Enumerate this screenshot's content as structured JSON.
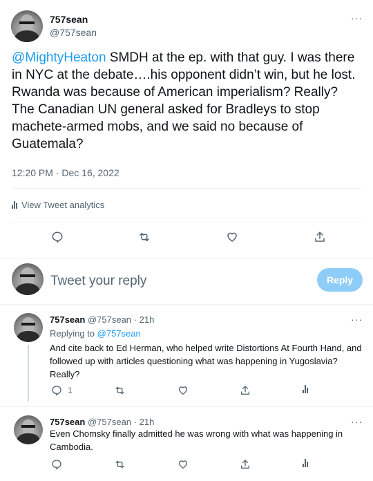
{
  "main_tweet": {
    "author_name": "757sean",
    "author_handle": "@757sean",
    "mention": "@MightyHeaton",
    "text": " SMDH at the ep. with that guy. I was there in NYC at the debate….his opponent didn’t win, but he lost. Rwanda was because of American imperialism? Really? The Canadian UN general asked for Bradleys to stop machete-armed mobs, and we said no because of Guatemala?",
    "timestamp": "12:20 PM · Dec 16, 2022",
    "analytics_label": "View Tweet analytics",
    "more_icon": "···"
  },
  "reply_box": {
    "placeholder": "Tweet your reply",
    "button_label": "Reply",
    "button_color": "#8ecdf8"
  },
  "replies": [
    {
      "author_name": "757sean",
      "author_handle": "@757sean",
      "separator": "·",
      "age": "21h",
      "replying_prefix": "Replying to ",
      "replying_to": "@757sean",
      "text": "And cite back to Ed Herman, who helped write Distortions At Fourth Hand, and followed up with articles questioning what was happening in Yugoslavia? Really?",
      "reply_count": "1",
      "more_icon": "···"
    },
    {
      "author_name": "757sean",
      "author_handle": "@757sean",
      "separator": "·",
      "age": "21h",
      "text": "Even Chomsky finally admitted he was wrong with what was happening in Cambodia.",
      "more_icon": "···"
    }
  ],
  "colors": {
    "accent": "#1d9bf0",
    "secondary_text": "#536471",
    "divider": "#eff3f4"
  }
}
